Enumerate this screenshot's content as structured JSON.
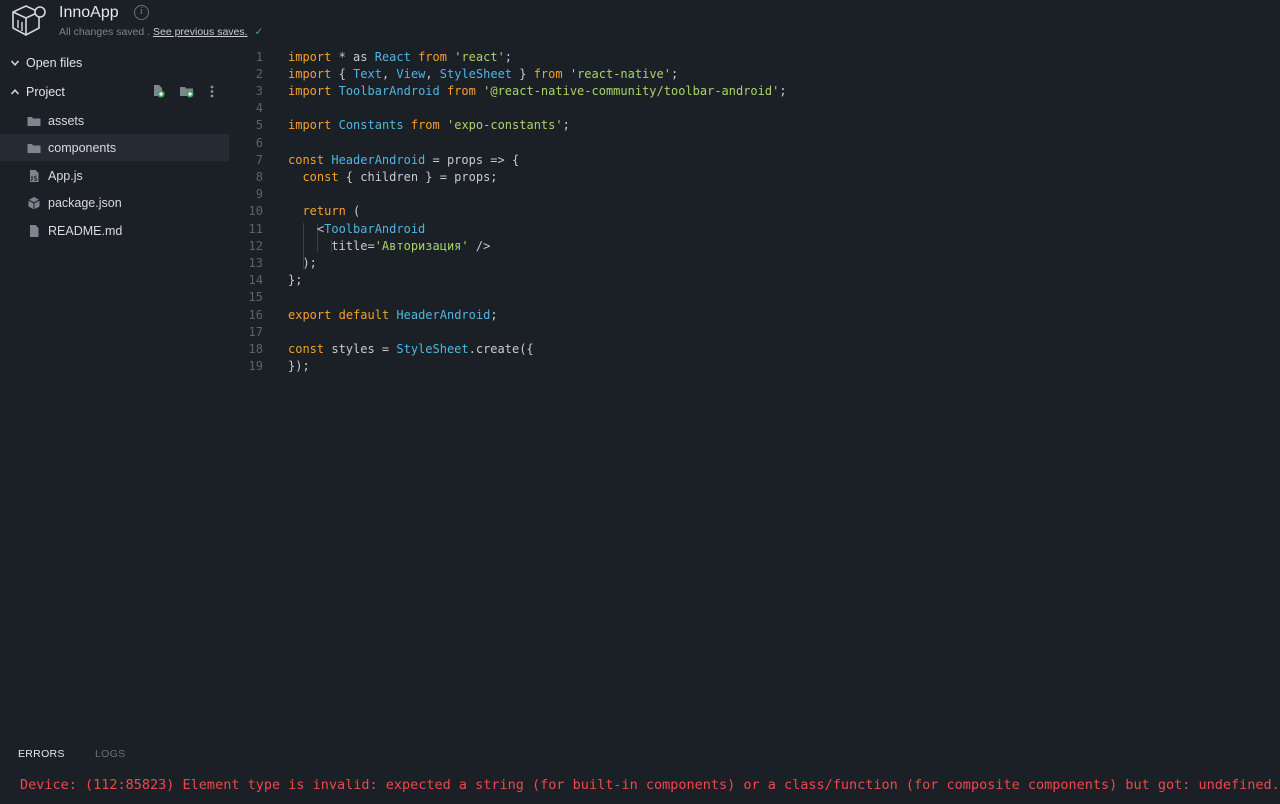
{
  "header": {
    "app_name": "InnoApp",
    "info_glyph": "i",
    "status_text": "All changes saved .",
    "see_previous_link": "See previous saves.",
    "saved_check": "✓"
  },
  "sidebar": {
    "open_files_label": "Open files",
    "project_label": "Project",
    "items": [
      {
        "label": "assets",
        "icon": "folder-icon"
      },
      {
        "label": "components",
        "icon": "folder-icon"
      },
      {
        "label": "App.js",
        "icon": "js-file-icon"
      },
      {
        "label": "package.json",
        "icon": "package-icon"
      },
      {
        "label": "README.md",
        "icon": "file-icon"
      }
    ]
  },
  "editor": {
    "line_numbers": [
      "1",
      "2",
      "3",
      "4",
      "5",
      "6",
      "7",
      "8",
      "9",
      "10",
      "11",
      "12",
      "13",
      "14",
      "15",
      "16",
      "17",
      "18",
      "19"
    ],
    "lines": [
      [
        [
          "kw",
          "import"
        ],
        [
          "p",
          " * as "
        ],
        [
          "id",
          "React"
        ],
        [
          "p",
          " "
        ],
        [
          "kw",
          "from"
        ],
        [
          "p",
          " "
        ],
        [
          "str",
          "'react'"
        ],
        [
          "p",
          ";"
        ]
      ],
      [
        [
          "kw",
          "import"
        ],
        [
          "p",
          " { "
        ],
        [
          "id",
          "Text"
        ],
        [
          "p",
          ", "
        ],
        [
          "id",
          "View"
        ],
        [
          "p",
          ", "
        ],
        [
          "id",
          "StyleSheet"
        ],
        [
          "p",
          " } "
        ],
        [
          "kw",
          "from"
        ],
        [
          "p",
          " "
        ],
        [
          "str",
          "'react-native'"
        ],
        [
          "p",
          ";"
        ]
      ],
      [
        [
          "kw",
          "import"
        ],
        [
          "p",
          " "
        ],
        [
          "id",
          "ToolbarAndroid"
        ],
        [
          "p",
          " "
        ],
        [
          "kw",
          "from"
        ],
        [
          "p",
          " "
        ],
        [
          "str",
          "'@react-native-community/toolbar-android'"
        ],
        [
          "p",
          ";"
        ]
      ],
      [],
      [
        [
          "kw",
          "import"
        ],
        [
          "p",
          " "
        ],
        [
          "id",
          "Constants"
        ],
        [
          "p",
          " "
        ],
        [
          "kw",
          "from"
        ],
        [
          "p",
          " "
        ],
        [
          "str",
          "'expo-constants'"
        ],
        [
          "p",
          ";"
        ]
      ],
      [],
      [
        [
          "kw",
          "const"
        ],
        [
          "p",
          " "
        ],
        [
          "id",
          "HeaderAndroid"
        ],
        [
          "p",
          " = props => {"
        ]
      ],
      [
        [
          "p",
          "  "
        ],
        [
          "kw",
          "const"
        ],
        [
          "p",
          " { children } = props;"
        ]
      ],
      [],
      [
        [
          "p",
          "  "
        ],
        [
          "kw",
          "return"
        ],
        [
          "p",
          " ("
        ]
      ],
      [
        [
          "p",
          "    <"
        ],
        [
          "id",
          "ToolbarAndroid"
        ]
      ],
      [
        [
          "p",
          "      title="
        ],
        [
          "str",
          "'Авторизация'"
        ],
        [
          "p",
          " />"
        ]
      ],
      [
        [
          "p",
          "  );"
        ]
      ],
      [
        [
          "p",
          "};"
        ]
      ],
      [],
      [
        [
          "kw",
          "export"
        ],
        [
          "p",
          " "
        ],
        [
          "kw",
          "default"
        ],
        [
          "p",
          " "
        ],
        [
          "id",
          "HeaderAndroid"
        ],
        [
          "p",
          ";"
        ]
      ],
      [],
      [
        [
          "kw",
          "const"
        ],
        [
          "p",
          " styles = "
        ],
        [
          "id",
          "StyleSheet"
        ],
        [
          "p",
          ".create({"
        ]
      ],
      [
        [
          "p",
          "});"
        ]
      ]
    ]
  },
  "bottom_panel": {
    "tabs": [
      "ERRORS",
      "LOGS"
    ],
    "error_message": "Device: (112:85823) Element type is invalid: expected a string (for built-in components) or a class/function (for composite components) but got: undefined."
  },
  "colors": {
    "background": "#1b1f26",
    "keyword": "#f4a02e",
    "identifier": "#4fb6e3",
    "string": "#a9d36a",
    "error": "#f04848",
    "saved_check": "#4aa564"
  }
}
